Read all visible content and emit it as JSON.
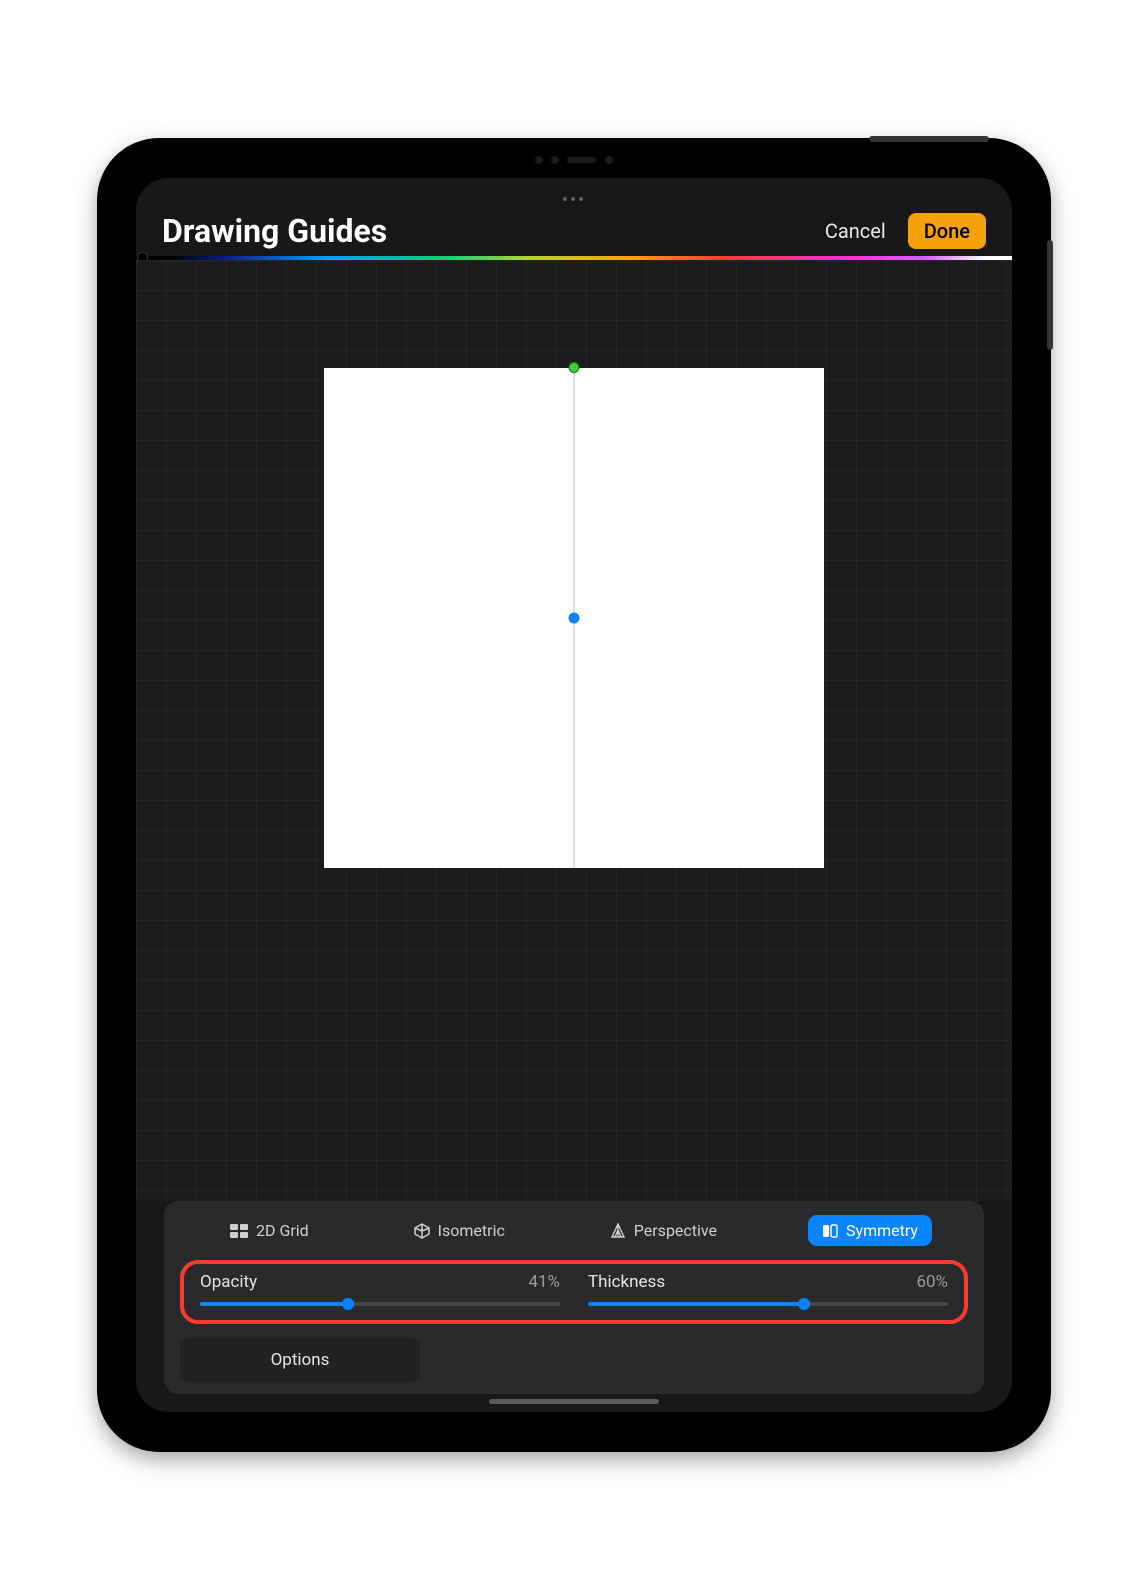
{
  "header": {
    "title": "Drawing Guides",
    "cancel": "Cancel",
    "done": "Done"
  },
  "segmented": {
    "grid": "2D Grid",
    "isometric": "Isometric",
    "perspective": "Perspective",
    "symmetry": "Symmetry"
  },
  "sliders": {
    "opacity": {
      "label": "Opacity",
      "value": "41%",
      "percent": 41
    },
    "thickness": {
      "label": "Thickness",
      "value": "60%",
      "percent": 60
    }
  },
  "options_label": "Options"
}
